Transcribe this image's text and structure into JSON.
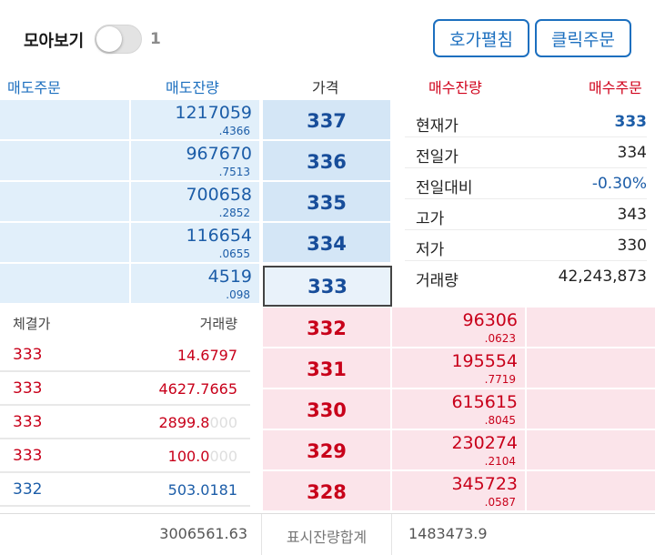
{
  "header": {
    "view_label": "모아보기",
    "toggle_on": false,
    "count": "1",
    "spread_button": "호가펼침",
    "click_order_button": "클릭주문"
  },
  "columns": {
    "sell_order": "매도주문",
    "sell_qty": "매도잔량",
    "price": "가격",
    "buy_qty": "매수잔량",
    "buy_order": "매수주문"
  },
  "asks": [
    {
      "price": "337",
      "qty": "1217059",
      "qty_sub": ".4366"
    },
    {
      "price": "336",
      "qty": "967670",
      "qty_sub": ".7513"
    },
    {
      "price": "335",
      "qty": "700658",
      "qty_sub": ".2852"
    },
    {
      "price": "334",
      "qty": "116654",
      "qty_sub": ".0655"
    },
    {
      "price": "333",
      "qty": "4519",
      "qty_sub": ".098"
    }
  ],
  "bids": [
    {
      "price": "332",
      "qty": "96306",
      "qty_sub": ".0623"
    },
    {
      "price": "331",
      "qty": "195554",
      "qty_sub": ".7719"
    },
    {
      "price": "330",
      "qty": "615615",
      "qty_sub": ".8045"
    },
    {
      "price": "329",
      "qty": "230274",
      "qty_sub": ".2104"
    },
    {
      "price": "328",
      "qty": "345723",
      "qty_sub": ".0587"
    }
  ],
  "info": [
    {
      "label": "현재가",
      "value": "333"
    },
    {
      "label": "전일가",
      "value": "334"
    },
    {
      "label": "전일대비",
      "value": "-0.30%"
    },
    {
      "label": "고가",
      "value": "343"
    },
    {
      "label": "저가",
      "value": "330"
    },
    {
      "label": "거래량",
      "value": "42,243,873"
    }
  ],
  "trades": {
    "head_price": "체결가",
    "head_volume": "거래량",
    "rows": [
      {
        "price": "333",
        "volume": "14.6797",
        "ghost": ""
      },
      {
        "price": "333",
        "volume": "4627.7665",
        "ghost": ""
      },
      {
        "price": "333",
        "volume": "2899.8",
        "ghost": "000"
      },
      {
        "price": "333",
        "volume": "100.0",
        "ghost": "000"
      },
      {
        "price": "332",
        "volume": "503.0181",
        "ghost": ""
      }
    ]
  },
  "totals": {
    "sell_total": "3006561.63",
    "label": "표시잔량합계",
    "buy_total": "1483473.9"
  },
  "colors": {
    "blue": "#1c5da8",
    "red": "#c8001a",
    "ask_bg": "#e1effa",
    "bid_bg": "#fbe4ea"
  }
}
